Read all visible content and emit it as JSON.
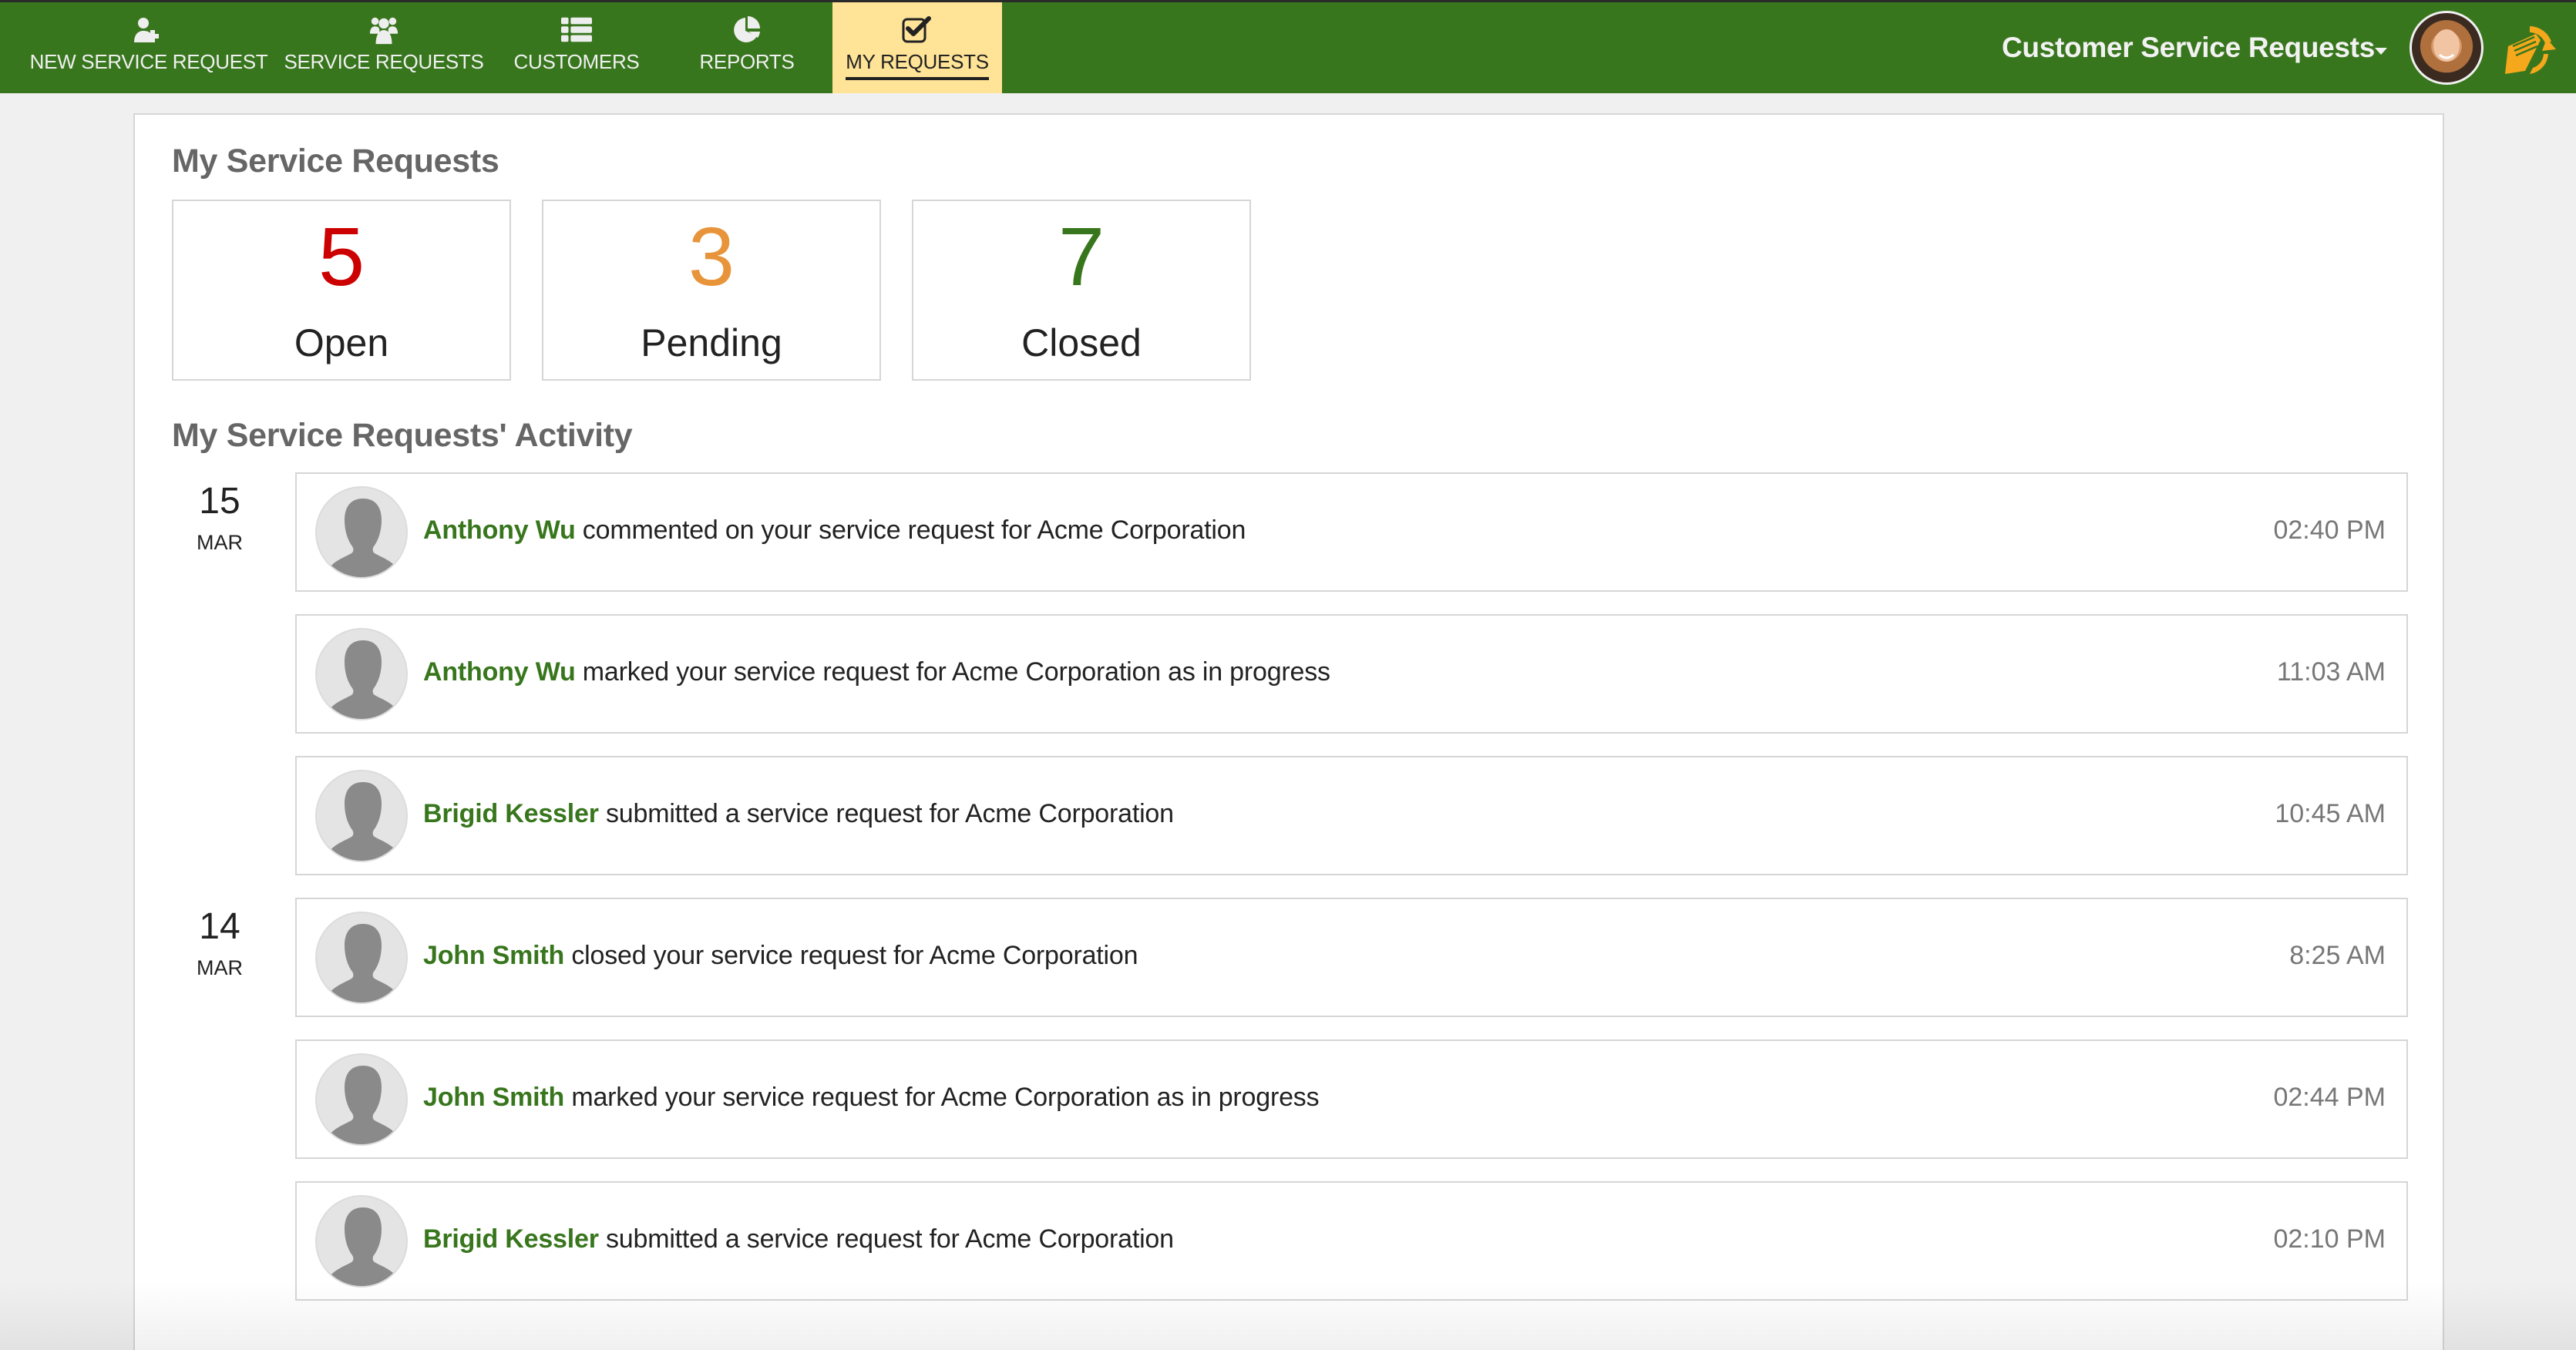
{
  "nav": {
    "items": [
      {
        "label": "NEW SERVICE REQUEST",
        "icon": "user-plus-icon",
        "active": false
      },
      {
        "label": "SERVICE REQUESTS",
        "icon": "users-icon",
        "active": false
      },
      {
        "label": "CUSTOMERS",
        "icon": "list-icon",
        "active": false
      },
      {
        "label": "REPORTS",
        "icon": "pie-chart-icon",
        "active": false
      },
      {
        "label": "MY REQUESTS",
        "icon": "check-square-icon",
        "active": true
      }
    ]
  },
  "header": {
    "app_title": "Customer Service Requests",
    "dropdown_icon": "caret-down-icon",
    "user_avatar": "user-photo",
    "logo": "brand-logo-icon"
  },
  "colors": {
    "header_bg": "#38761d",
    "active_tab_bg": "#ffe397",
    "open": "#cc0000",
    "pending": "#e8943a",
    "closed": "#38761d",
    "actor": "#38761d",
    "time": "#777777"
  },
  "summary": {
    "title": "My Service Requests",
    "stats": [
      {
        "value": "5",
        "label": "Open"
      },
      {
        "value": "3",
        "label": "Pending"
      },
      {
        "value": "7",
        "label": "Closed"
      }
    ]
  },
  "activity": {
    "title": "My Service Requests' Activity",
    "dates": [
      {
        "day": "15",
        "month": "MAR"
      },
      {
        "day": "14",
        "month": "MAR"
      }
    ],
    "items": [
      {
        "actor": "Anthony Wu",
        "action": " commented on your service request for Acme Corporation",
        "time": "02:40 PM"
      },
      {
        "actor": "Anthony Wu",
        "action": " marked your service request for Acme Corporation as in progress",
        "time": "11:03 AM"
      },
      {
        "actor": "Brigid Kessler",
        "action": " submitted a service request for Acme Corporation",
        "time": "10:45 AM"
      },
      {
        "actor": "John Smith",
        "action": " closed your service request for Acme Corporation",
        "time": "8:25 AM"
      },
      {
        "actor": "John Smith",
        "action": " marked your service request for Acme Corporation as in progress",
        "time": "02:44 PM"
      },
      {
        "actor": "Brigid Kessler",
        "action": " submitted a service request for Acme Corporation",
        "time": "02:10 PM"
      }
    ]
  }
}
